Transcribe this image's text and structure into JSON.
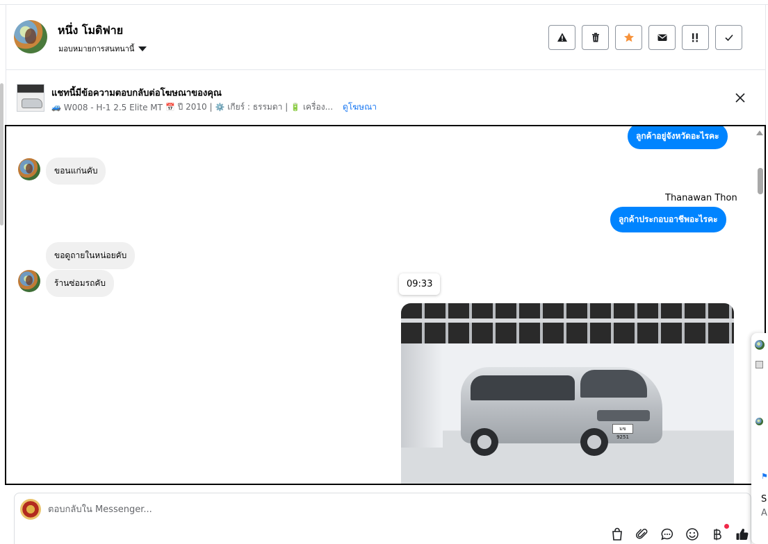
{
  "header": {
    "name": "หนึ่ง โมดิฟาย",
    "assign_label": "มอบหมายการสนทนานี้"
  },
  "actions": {
    "spam": "spam-icon",
    "delete": "trash-icon",
    "star": "star-icon",
    "unread": "envelope-icon",
    "follow_up": "follow-up-icon",
    "done": "check-icon"
  },
  "ad": {
    "title": "แชทนี้มีข้อความตอบกลับต่อโฆษณาของคุณ",
    "car_icon": "🚙",
    "code": "W008 - H-1 2.5 Elite MT",
    "cal_icon": "📅",
    "year": "ปี 2010 |",
    "gear_icon": "⚙️",
    "gear": "เกียร์ : ธรรมดา |",
    "engine_icon": "🔋",
    "engine": "เครื่อง...",
    "view_link": "ดูโฆษณา"
  },
  "messages": {
    "out_1": "ลูกค้าอยู่จังหวัดอะไรคะ",
    "in_1": "ขอนแก่นคับ",
    "sender": "Thanawan Thon",
    "out_2": "ลูกค้าประกอบอาชีพอะไรคะ",
    "in_2": "ขอดูถายในหน่อยคับ",
    "in_3": "ร้านซ่อมรถคับ",
    "time": "09:33",
    "plate": "มข 9251"
  },
  "composer": {
    "placeholder": "ตอบกลับใน Messenger..."
  },
  "side": {
    "letter_1": "S",
    "letter_2": "A"
  },
  "colors": {
    "accent": "#0084ff",
    "link": "#1877f2",
    "star": "#f7923a"
  }
}
